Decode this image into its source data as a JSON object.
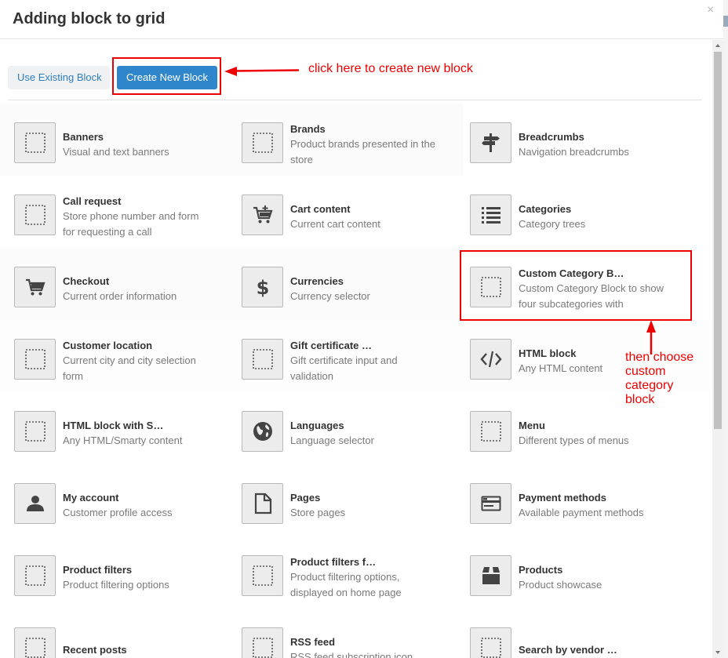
{
  "dialog": {
    "title": "Adding block to grid",
    "close_label": "×"
  },
  "tabs": {
    "existing": "Use Existing Block",
    "create": "Create New Block"
  },
  "annotations": {
    "create_hint": "click here to create new block",
    "category_hint": [
      "then choose",
      "custom category",
      "block"
    ],
    "color": "#e00000"
  },
  "accent_color": "#2f86cb",
  "blocks": [
    {
      "title": "Banners",
      "desc": "Visual and text banners",
      "icon": "placeholder-icon"
    },
    {
      "title": "Brands",
      "desc": "Product brands presented in the store",
      "icon": "placeholder-icon"
    },
    {
      "title": "Breadcrumbs",
      "desc": "Navigation breadcrumbs",
      "icon": "signpost-icon"
    },
    {
      "title": "Call request",
      "desc": "Store phone number and form for requesting a call",
      "icon": "placeholder-icon"
    },
    {
      "title": "Cart content",
      "desc": "Current cart content",
      "icon": "cart-plus-icon"
    },
    {
      "title": "Categories",
      "desc": "Category trees",
      "icon": "list-icon"
    },
    {
      "title": "Checkout",
      "desc": "Current order information",
      "icon": "cart-icon"
    },
    {
      "title": "Currencies",
      "desc": "Currency selector",
      "icon": "dollar-icon"
    },
    {
      "title": "Custom Category B…",
      "desc": "Custom Category Block to show four subcategories with",
      "icon": "placeholder-icon"
    },
    {
      "title": "Customer location",
      "desc": "Current city and city selection form",
      "icon": "placeholder-icon"
    },
    {
      "title": "Gift certificate …",
      "desc": "Gift certificate input and validation",
      "icon": "placeholder-icon"
    },
    {
      "title": "HTML block",
      "desc": "Any HTML content",
      "icon": "code-icon"
    },
    {
      "title": "HTML block with S…",
      "desc": "Any HTML/Smarty content",
      "icon": "placeholder-icon"
    },
    {
      "title": "Languages",
      "desc": "Language selector",
      "icon": "globe-icon"
    },
    {
      "title": "Menu",
      "desc": "Different types of menus",
      "icon": "placeholder-icon"
    },
    {
      "title": "My account",
      "desc": "Customer profile access",
      "icon": "user-icon"
    },
    {
      "title": "Pages",
      "desc": "Store pages",
      "icon": "page-icon"
    },
    {
      "title": "Payment methods",
      "desc": "Available payment methods",
      "icon": "credit-card-icon"
    },
    {
      "title": "Product filters",
      "desc": "Product filtering options",
      "icon": "placeholder-icon"
    },
    {
      "title": "Product filters f…",
      "desc": "Product filtering options, displayed on home page",
      "icon": "placeholder-icon"
    },
    {
      "title": "Products",
      "desc": "Product showcase",
      "icon": "box-icon"
    },
    {
      "title": "Recent posts",
      "desc": "",
      "icon": "placeholder-icon"
    },
    {
      "title": "RSS feed",
      "desc": "RSS feed subscription icon",
      "icon": "placeholder-icon"
    },
    {
      "title": "Search by vendor …",
      "desc": "",
      "icon": "placeholder-icon"
    }
  ]
}
